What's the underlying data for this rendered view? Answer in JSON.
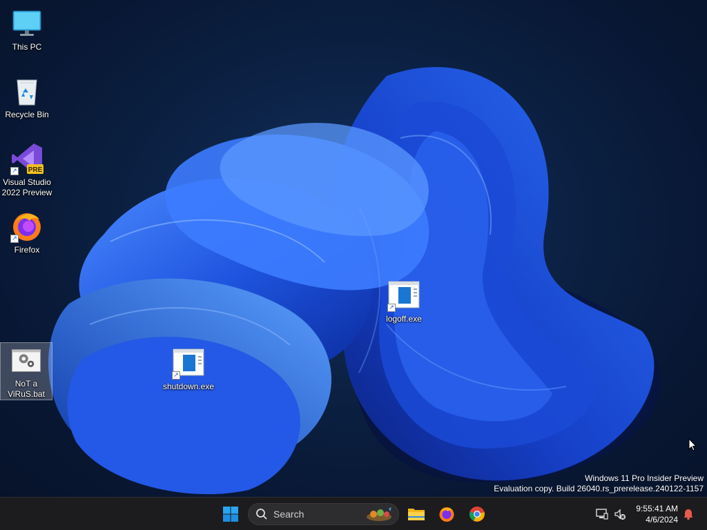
{
  "desktop": {
    "icons": [
      {
        "label": "This PC",
        "icon": "monitor-icon",
        "shortcut": false
      },
      {
        "label": "Recycle Bin",
        "icon": "recycle-bin-icon",
        "shortcut": false
      },
      {
        "label": "Visual Studio\n2022 Preview",
        "icon": "visual-studio-icon",
        "badge": "PRE",
        "shortcut": true
      },
      {
        "label": "Firefox",
        "icon": "firefox-icon",
        "shortcut": true
      },
      {
        "label": "NoT a\nViRuS.bat",
        "icon": "batch-file-icon",
        "shortcut": false,
        "selected": true
      },
      {
        "label": "shutdown.exe",
        "icon": "exe-app-icon",
        "shortcut": true
      },
      {
        "label": "logoff.exe",
        "icon": "exe-app-icon",
        "shortcut": true
      }
    ],
    "watermark": {
      "line1": "Windows 11 Pro Insider Preview",
      "line2": "Evaluation copy. Build 26040.rs_prerelease.240122-1157"
    }
  },
  "taskbar": {
    "start_icon": "windows-start-icon",
    "search": {
      "placeholder": "Search",
      "icon": "search-icon"
    },
    "pinned": [
      {
        "name": "File Explorer",
        "icon": "folder-icon"
      },
      {
        "name": "Firefox",
        "icon": "firefox-icon"
      },
      {
        "name": "Google Chrome",
        "icon": "chrome-icon"
      }
    ],
    "tray": {
      "time": "9:55:41 AM",
      "date": "4/6/2024"
    }
  },
  "colors": {
    "accent": "#0a6cff",
    "taskbar_bg": "#1c1c1e",
    "wallpaper_dark": "#081733",
    "bloom_blue": "#1a4fd8"
  }
}
